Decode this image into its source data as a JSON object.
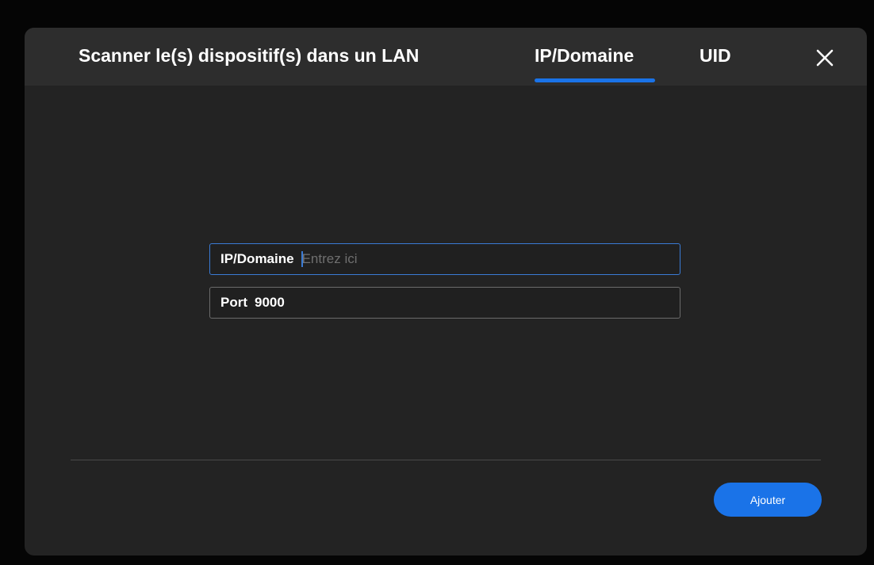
{
  "dialog": {
    "tabs": [
      {
        "label": "Scanner le(s) dispositif(s) dans un LAN",
        "active": false
      },
      {
        "label": "IP/Domaine",
        "active": true
      },
      {
        "label": "UID",
        "active": false
      }
    ],
    "close_icon": "close-icon"
  },
  "form": {
    "ip_field": {
      "label": "IP/Domaine",
      "placeholder": "Entrez ici",
      "value": ""
    },
    "port_field": {
      "label": "Port",
      "value": "9000"
    }
  },
  "footer": {
    "add_label": "Ajouter"
  },
  "colors": {
    "accent": "#1a73e8",
    "dialog_bg": "#232323",
    "header_bg": "#2d2d2d"
  }
}
